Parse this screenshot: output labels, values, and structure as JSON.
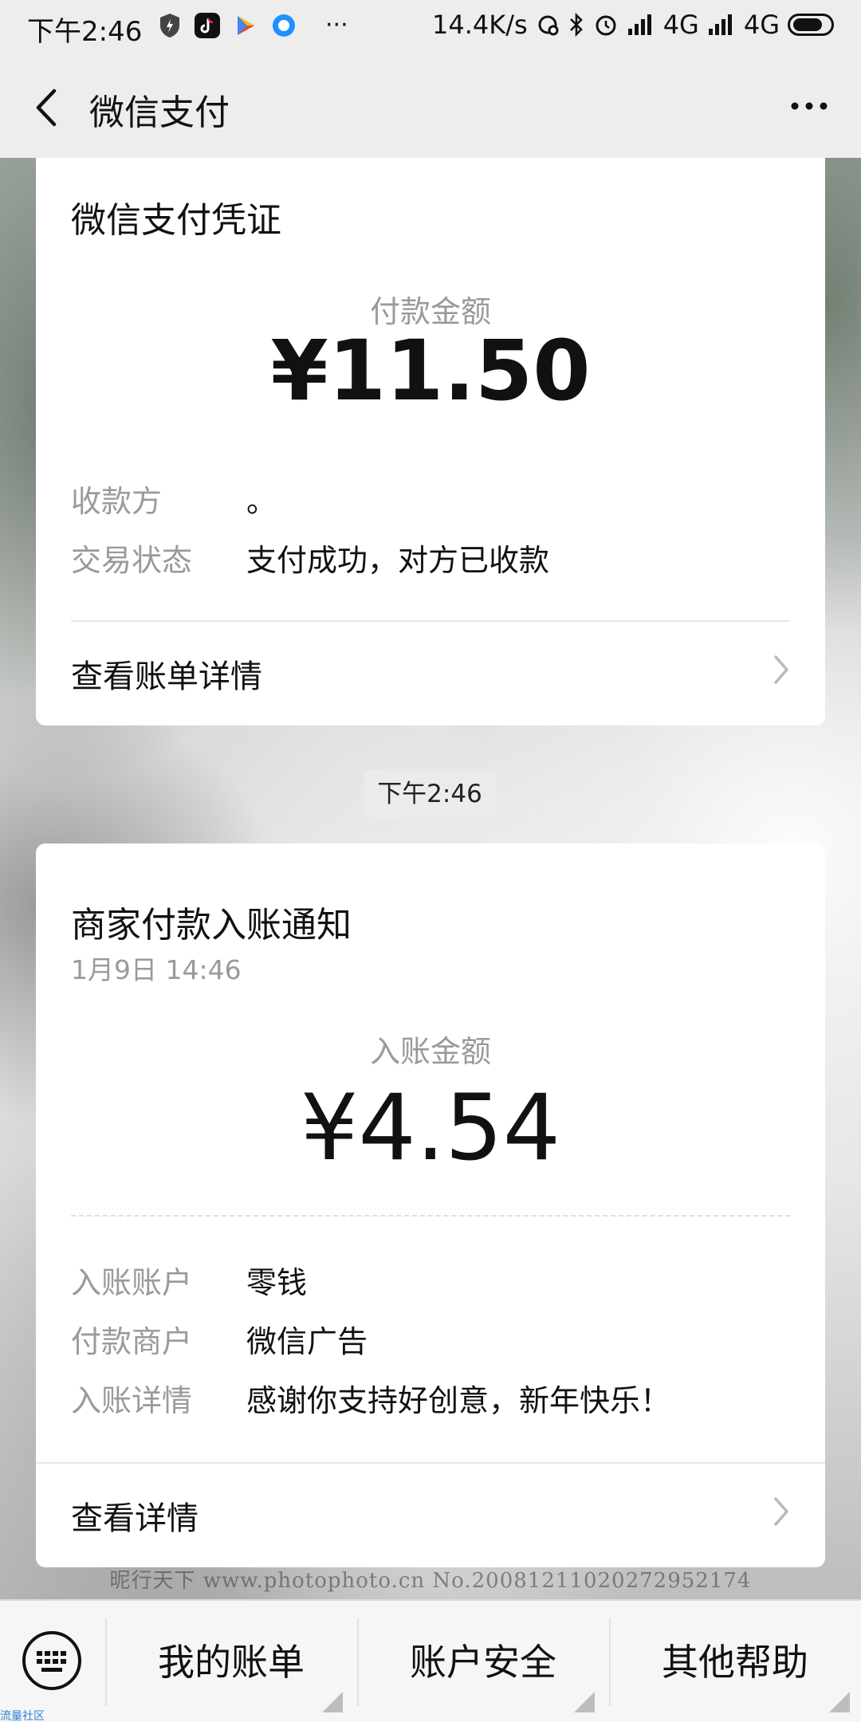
{
  "status_bar": {
    "time": "下午2:46",
    "more": "···",
    "speed": "14.4K/s",
    "network1": "4G",
    "network2": "4G"
  },
  "header": {
    "title": "微信支付"
  },
  "card1": {
    "title": "微信支付凭证",
    "amount_label": "付款金额",
    "amount": "¥11.50",
    "rows": [
      {
        "label": "收款方",
        "value": "。"
      },
      {
        "label": "交易状态",
        "value": "支付成功，对方已收款"
      }
    ],
    "link": "查看账单详情"
  },
  "time_badge": "下午2:46",
  "card2": {
    "title": "商家付款入账通知",
    "date": "1月9日  14:46",
    "amount_label": "入账金额",
    "amount": "¥4.54",
    "rows": [
      {
        "label": "入账账户",
        "value": "零钱"
      },
      {
        "label": "付款商户",
        "value": "微信广告"
      },
      {
        "label": "入账详情",
        "value": "感谢你支持好创意，新年快乐！"
      }
    ],
    "link": "查看详情"
  },
  "watermark": "昵行天下  www.photophoto.cn   No.20081211020272952174",
  "menu": {
    "items": [
      "我的账单",
      "账户安全",
      "其他帮助"
    ]
  },
  "corner_tag": "流量社区",
  "colors": {
    "accent_text": "#111111",
    "secondary_text": "#9a9a9a",
    "bar_bg": "#ededed"
  }
}
